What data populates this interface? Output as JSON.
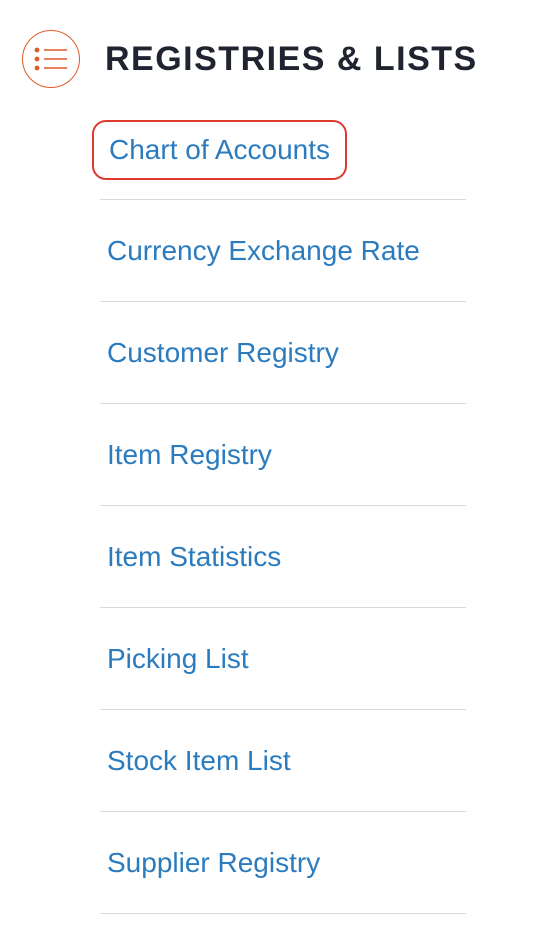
{
  "header": {
    "title": "REGISTRIES & LISTS",
    "icon": "list-icon",
    "accent_color": "#e05a2b"
  },
  "menu": {
    "link_color": "#2b7bbf",
    "selected_outline_color": "#dd3b30",
    "items": [
      {
        "label": "Chart of Accounts",
        "selected": true
      },
      {
        "label": "Currency Exchange Rate",
        "selected": false
      },
      {
        "label": "Customer Registry",
        "selected": false
      },
      {
        "label": "Item Registry",
        "selected": false
      },
      {
        "label": "Item Statistics",
        "selected": false
      },
      {
        "label": "Picking List",
        "selected": false
      },
      {
        "label": "Stock Item List",
        "selected": false
      },
      {
        "label": "Supplier Registry",
        "selected": false
      }
    ]
  }
}
